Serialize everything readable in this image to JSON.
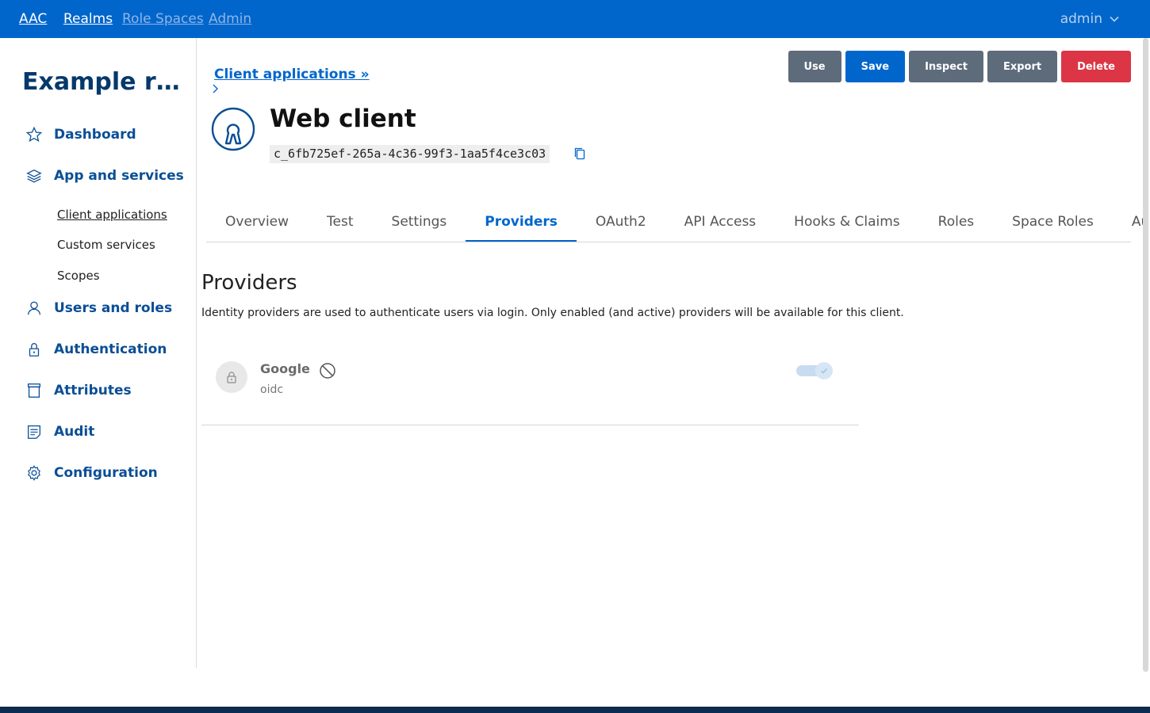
{
  "navbar": {
    "brand": "AAC",
    "links": [
      "Realms",
      "Role Spaces",
      "Admin"
    ],
    "user": "admin"
  },
  "sidebar": {
    "realm_title": "Example realm",
    "items": [
      {
        "label": "Dashboard",
        "icon": "star-icon"
      },
      {
        "label": "App and services",
        "icon": "layers-icon"
      },
      {
        "label": "Users and roles",
        "icon": "user-icon"
      },
      {
        "label": "Authentication",
        "icon": "lock-icon"
      },
      {
        "label": "Attributes",
        "icon": "archive-icon"
      },
      {
        "label": "Audit",
        "icon": "notes-icon"
      },
      {
        "label": "Configuration",
        "icon": "gear-icon"
      }
    ],
    "subitems": [
      "Client applications",
      "Custom services",
      "Scopes"
    ]
  },
  "header": {
    "breadcrumb": "Client applications »",
    "client_name": "Web client",
    "client_id": "c_6fb725ef-265a-4c36-99f3-1aa5f4ce3c03"
  },
  "actions": [
    "Use",
    "Save",
    "Inspect",
    "Export",
    "Delete"
  ],
  "tabs": [
    "Overview",
    "Test",
    "Settings",
    "Providers",
    "OAuth2",
    "API Access",
    "Hooks & Claims",
    "Roles",
    "Space Roles",
    "Audit"
  ],
  "active_tab": "Providers",
  "providers_section": {
    "title": "Providers",
    "description": "Identity providers are used to authenticate users via login. Only enabled (and active) providers will be available for this client.",
    "providers": [
      {
        "name": "Google",
        "type": "oidc",
        "enabled": true,
        "active": false
      }
    ]
  },
  "colors": {
    "primary": "#0066cc",
    "danger": "#dc3545",
    "secondary": "#5d6b7b",
    "realm_title": "#06396b"
  }
}
